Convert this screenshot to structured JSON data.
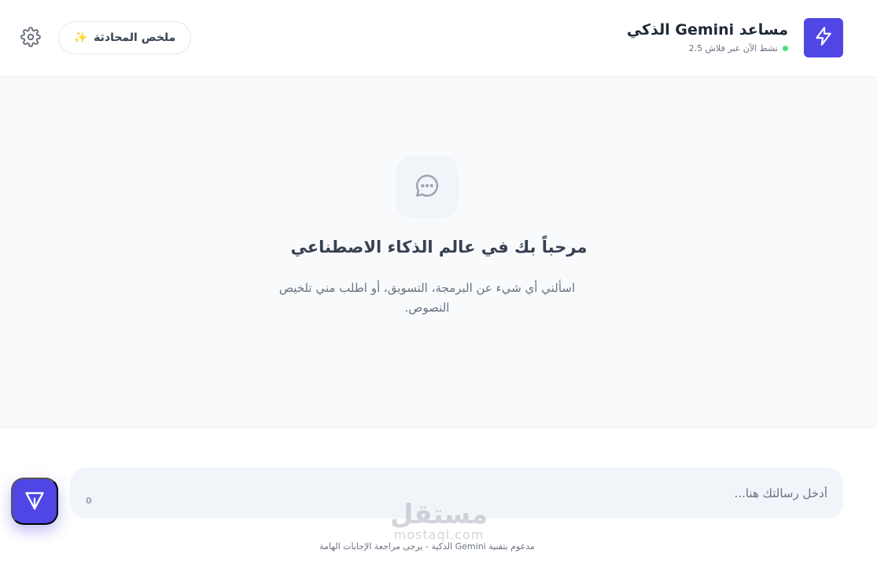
{
  "header": {
    "title": "مساعد Gemini الذكي",
    "status": "نشط الآن عبر فلاش 2.5",
    "summary_label": "ملخص المحادثة",
    "summary_icon": "sparkles-icon",
    "settings_icon": "gear-icon",
    "logo_icon": "lightning-icon"
  },
  "welcome": {
    "icon": "chat-bubble-icon",
    "title": "مرحباً بك في عالم الذكاء الاصطناعي",
    "subtitle": "اسألني أي شيء عن البرمجة، التسويق، أو اطلب مني تلخيص النصوص."
  },
  "composer": {
    "placeholder": "أدخل رسالتك هنا...",
    "char_count": "0",
    "send_icon": "send-icon"
  },
  "footer": {
    "watermark_main": "مستقل",
    "watermark_sub": "mostaql.com",
    "powered_by": "مدعوم بتقنية Gemini الذكية - يرجى مراجعة الإجابات الهامة"
  },
  "colors": {
    "accent": "#4f46e5",
    "status_dot": "#4ade80",
    "sparkle": "#f59e0b"
  }
}
